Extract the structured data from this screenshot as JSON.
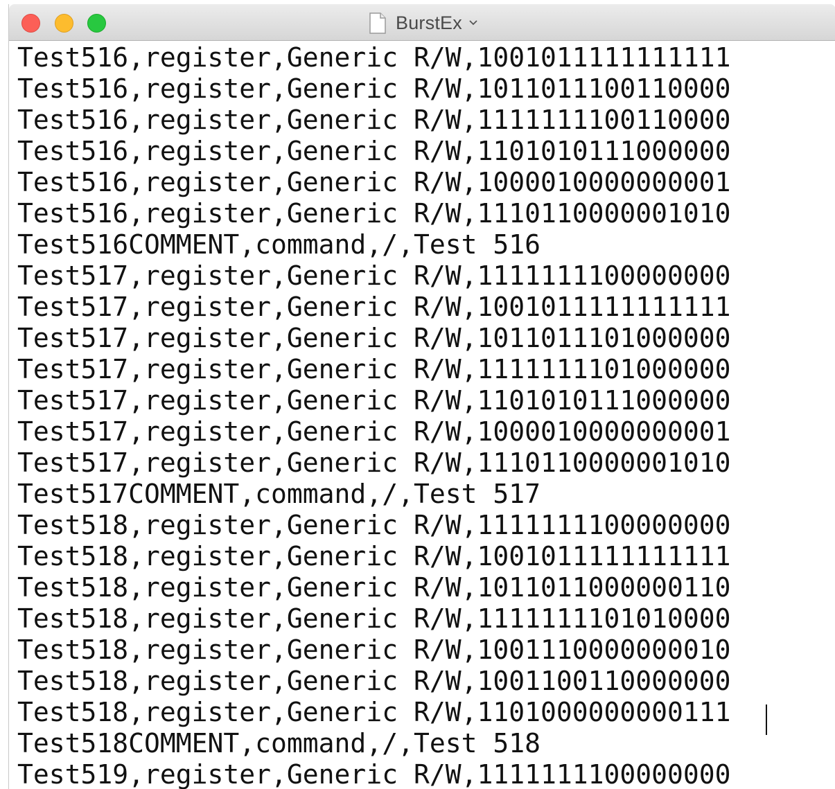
{
  "window": {
    "title": "BurstEx",
    "title_icon": "document-icon",
    "traffic_lights": {
      "close_color": "#fc5f57",
      "minimize_color": "#fdbc2e",
      "zoom_color": "#28c840"
    }
  },
  "editor": {
    "lines": [
      "Test516,register,Generic R/W,1001011111111111",
      "Test516,register,Generic R/W,1011011100110000",
      "Test516,register,Generic R/W,1111111100110000",
      "Test516,register,Generic R/W,1101010111000000",
      "Test516,register,Generic R/W,1000010000000001",
      "Test516,register,Generic R/W,1110110000001010",
      "Test516COMMENT,command,/,Test 516",
      "Test517,register,Generic R/W,1111111100000000",
      "Test517,register,Generic R/W,1001011111111111",
      "Test517,register,Generic R/W,1011011101000000",
      "Test517,register,Generic R/W,1111111101000000",
      "Test517,register,Generic R/W,1101010111000000",
      "Test517,register,Generic R/W,1000010000000001",
      "Test517,register,Generic R/W,1110110000001010",
      "Test517COMMENT,command,/,Test 517",
      "Test518,register,Generic R/W,1111111100000000",
      "Test518,register,Generic R/W,1001011111111111",
      "Test518,register,Generic R/W,1011011000000110",
      "Test518,register,Generic R/W,1111111101010000",
      "Test518,register,Generic R/W,1001110000000010",
      "Test518,register,Generic R/W,1001100110000000",
      "Test518,register,Generic R/W,1101000000000111",
      "Test518COMMENT,command,/,Test 518",
      "Test519,register,Generic R/W,1111111100000000"
    ]
  }
}
